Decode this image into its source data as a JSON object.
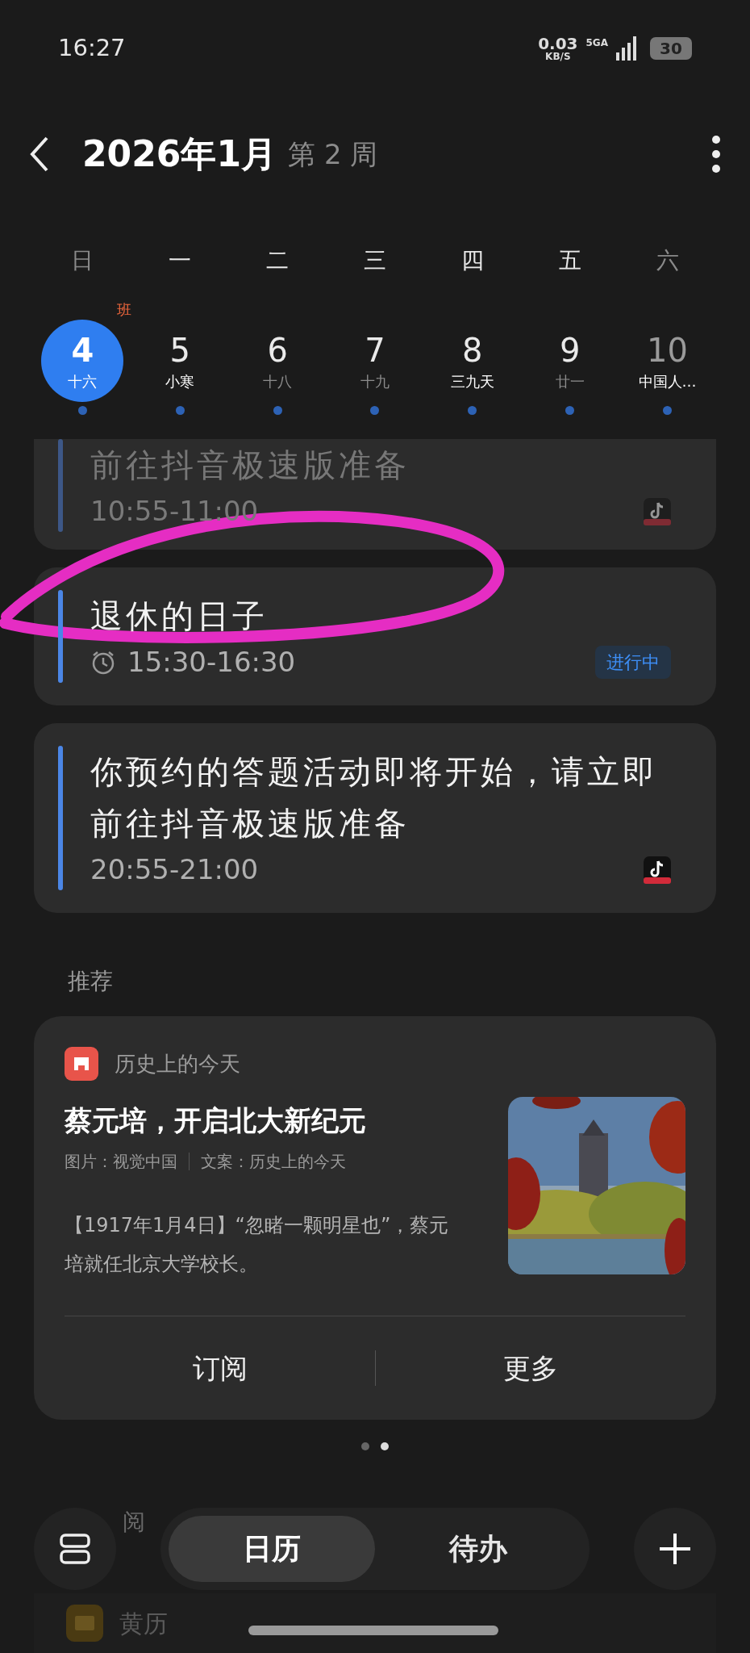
{
  "status_bar": {
    "time": "16:27",
    "net_speed": "0.03",
    "net_unit": "KB/S",
    "network": "5GA",
    "battery": "30"
  },
  "header": {
    "title": "2026年1月",
    "week": "第 2 周"
  },
  "weekdays": [
    {
      "label": "日",
      "weekend": true
    },
    {
      "label": "一",
      "weekend": false
    },
    {
      "label": "二",
      "weekend": false
    },
    {
      "label": "三",
      "weekend": false
    },
    {
      "label": "四",
      "weekend": false
    },
    {
      "label": "五",
      "weekend": false
    },
    {
      "label": "六",
      "weekend": true
    }
  ],
  "days": [
    {
      "day": "4",
      "lunar": "十六",
      "selected": true,
      "badge": "班",
      "event_dot": true
    },
    {
      "day": "5",
      "lunar": "小寒",
      "selected": false,
      "highlight": true,
      "weekend": false,
      "event_dot": true
    },
    {
      "day": "6",
      "lunar": "十八",
      "selected": false,
      "highlight": false,
      "weekend": false,
      "event_dot": true
    },
    {
      "day": "7",
      "lunar": "十九",
      "selected": false,
      "highlight": false,
      "weekend": false,
      "event_dot": true
    },
    {
      "day": "8",
      "lunar": "三九天",
      "selected": false,
      "highlight": true,
      "weekend": false,
      "event_dot": true
    },
    {
      "day": "9",
      "lunar": "廿一",
      "selected": false,
      "highlight": false,
      "weekend": false,
      "event_dot": true
    },
    {
      "day": "10",
      "lunar": "中国人…",
      "selected": false,
      "highlight": true,
      "weekend": true,
      "event_dot": true
    }
  ],
  "events": [
    {
      "title": "前往抖音极速版准备",
      "time": "10:55-11:00",
      "alarm": false,
      "past": true,
      "app_icon": true
    },
    {
      "title": "退休的日子",
      "time": "15:30-16:30",
      "alarm": true,
      "past": false,
      "app_icon": false,
      "status": "进行中"
    },
    {
      "title": "你预约的答题活动即将开始，请立即前往抖音极速版准备",
      "time": "20:55-21:00",
      "alarm": false,
      "past": false,
      "app_icon": true
    }
  ],
  "recommend": {
    "label": "推荐",
    "source": "历史上的今天",
    "headline": "蔡元培，开启北大新纪元",
    "credit_image": "图片：视觉中国",
    "credit_text": "文案：历史上的今天",
    "body": "【1917年1月4日】“忽睹一颗明星也”，蔡元培就任北京大学校长。",
    "picture": {
      "kind": "picture"
    },
    "actions": [
      "订阅",
      "更多"
    ]
  },
  "page_dots": [
    {
      "selected": false
    },
    {
      "selected": true
    }
  ],
  "subscriptions": {
    "label": "阅",
    "items": [
      "黄历"
    ]
  },
  "bottom_tabs": [
    {
      "label": "日历",
      "selected": true
    },
    {
      "label": "待办",
      "selected": false
    }
  ]
}
